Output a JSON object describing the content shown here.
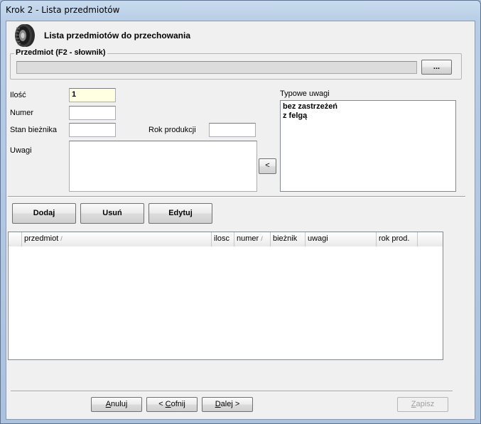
{
  "window": {
    "title": "Krok 2 - Lista przedmiotów"
  },
  "header": {
    "title": "Lista przedmiotów do przechowania",
    "icon": "tire-icon"
  },
  "item_group": {
    "legend": "Przedmiot (F2 - słownik)",
    "browse_label": "..."
  },
  "form": {
    "quantity_label": "Ilość",
    "quantity_value": "1",
    "number_label": "Numer",
    "number_value": "",
    "tread_label": "Stan bieżnika",
    "tread_value": "",
    "year_label": "Rok produkcji",
    "year_value": "",
    "notes_label": "Uwagi",
    "notes_value": ""
  },
  "typical_notes": {
    "label": "Typowe uwagi",
    "items": [
      "bez zastrzeżeń",
      "z felgą"
    ],
    "insert_button": "<"
  },
  "actions": {
    "add": "Dodaj",
    "remove": "Usuń",
    "edit": "Edytuj"
  },
  "table": {
    "columns": [
      "",
      "przedmiot",
      "ilosc",
      "numer",
      "bieżnik",
      "uwagi",
      "rok prod.",
      ""
    ],
    "sort_glyph": "/",
    "rows": []
  },
  "footer": {
    "cancel_pre": "",
    "cancel_u": "A",
    "cancel_post": "nuluj",
    "back_pre": "< ",
    "back_u": "C",
    "back_post": "ofnij",
    "next_pre": "",
    "next_u": "D",
    "next_post": "alej >",
    "save_pre": "",
    "save_u": "Z",
    "save_post": "apisz"
  },
  "colors": {
    "accent_input": "#ffffe1",
    "disabled": "#dcdcdc",
    "window_frame": "#aac2de"
  }
}
